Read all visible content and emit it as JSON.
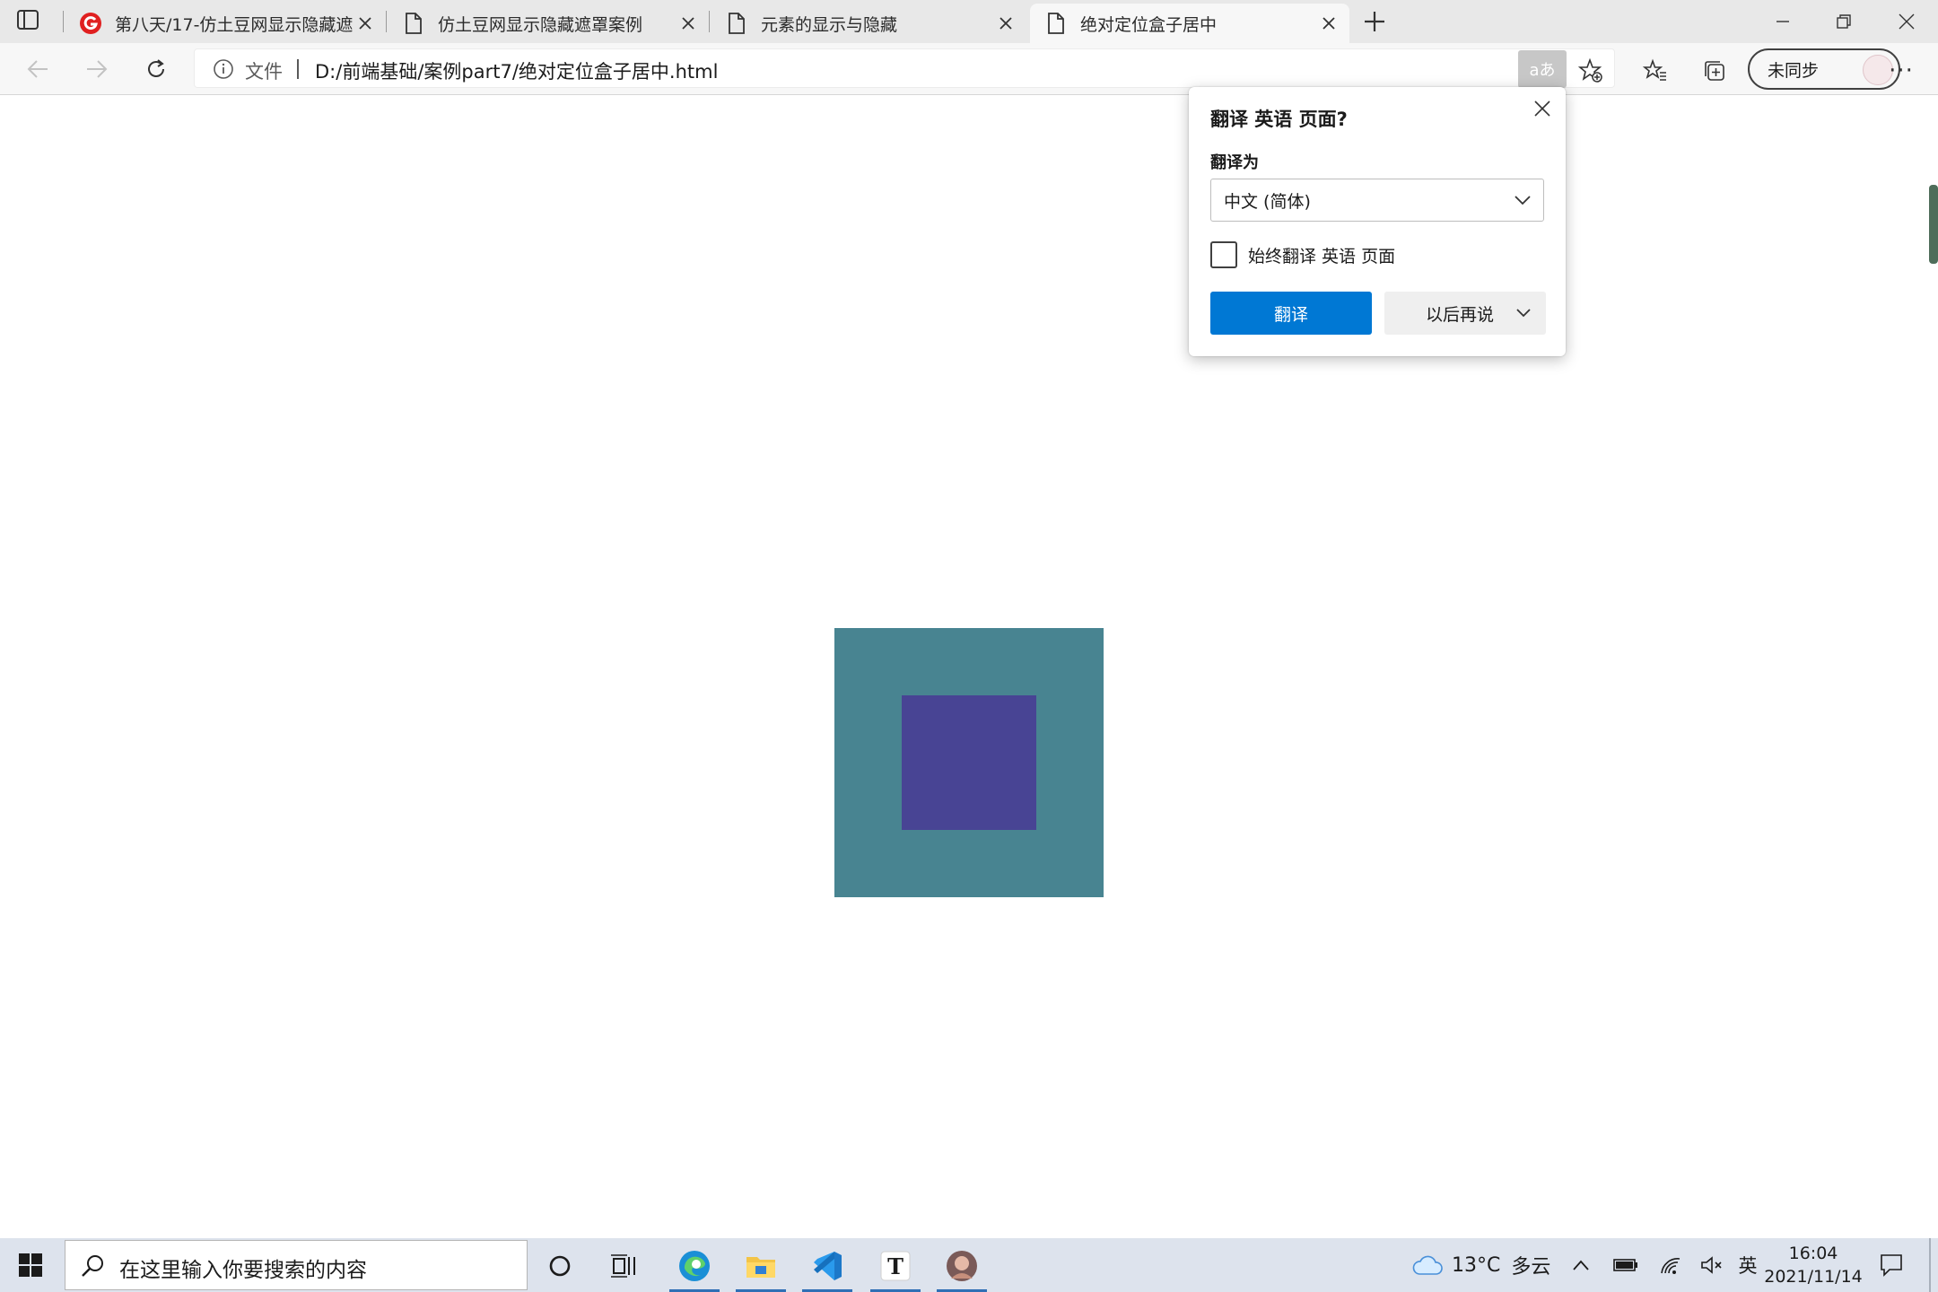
{
  "browser": {
    "tabs": [
      {
        "title": "第八天/17-仿土豆网显示隐藏遮罩",
        "favicon": "g-logo-icon",
        "active": false
      },
      {
        "title": "仿土豆网显示隐藏遮罩案例",
        "favicon": "file-icon",
        "active": false
      },
      {
        "title": "元素的显示与隐藏",
        "favicon": "file-icon",
        "active": false
      },
      {
        "title": "绝对定位盒子居中",
        "favicon": "file-icon",
        "active": true
      }
    ],
    "address": {
      "scheme_label": "文件",
      "url": "D:/前端基础/案例part7/绝对定位盒子居中.html"
    },
    "translate_icon_text": "aあ",
    "profile_label": "未同步",
    "more_label": "···"
  },
  "translate_popup": {
    "title": "翻译 英语 页面?",
    "translate_to_label": "翻译为",
    "selected_language": "中文 (简体)",
    "always_translate_label": "始终翻译 英语 页面",
    "always_translate_checked": false,
    "translate_button": "翻译",
    "later_button": "以后再说"
  },
  "page": {
    "outer_box_color": "#488491",
    "inner_box_color": "#484494"
  },
  "taskbar": {
    "search_placeholder": "在这里输入你要搜索的内容",
    "weather_temp": "13°C",
    "weather_desc": "多云",
    "ime_label": "英",
    "time": "16:04",
    "date": "2021/11/14",
    "apps": [
      "edge-icon",
      "file-explorer-icon",
      "vscode-icon",
      "typora-icon",
      "user-photo-icon"
    ]
  },
  "colors": {
    "accent": "#0078d4",
    "tabstrip": "#e8e8e8",
    "taskbar": "#dde3ed"
  }
}
